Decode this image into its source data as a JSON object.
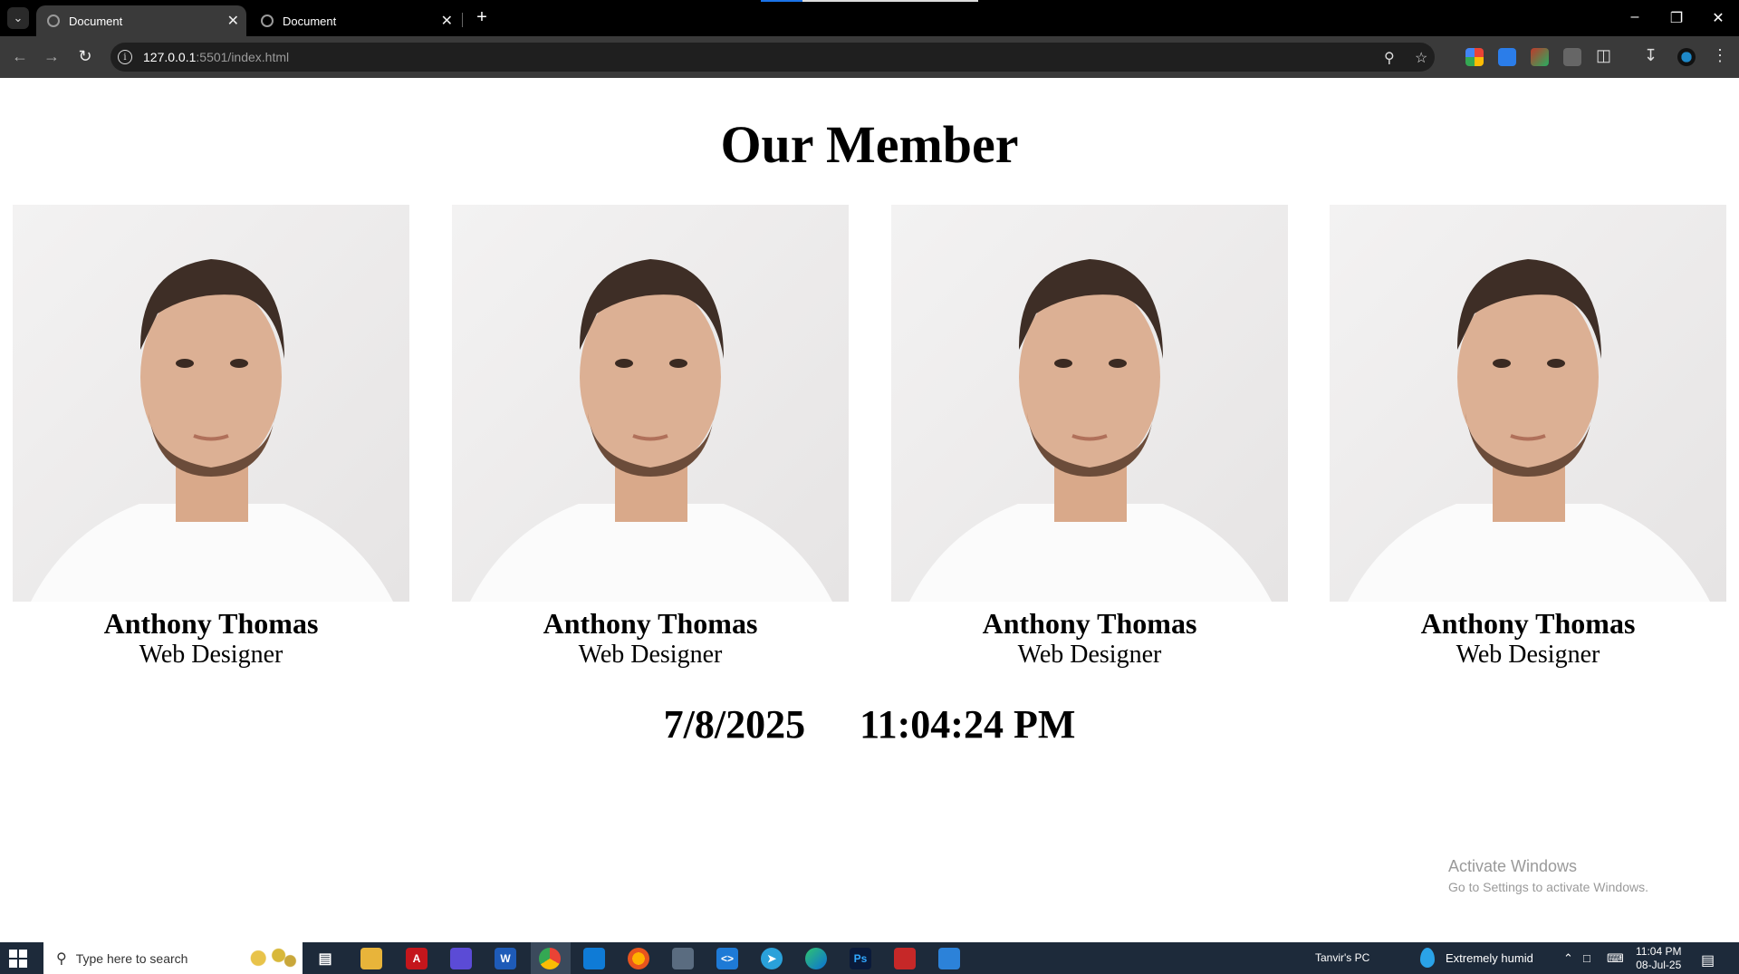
{
  "browser": {
    "tabs": [
      {
        "title": "Document",
        "active": true
      },
      {
        "title": "Document",
        "active": false
      }
    ],
    "new_tab_label": "+",
    "address": {
      "host": "127.0.0.1",
      "rest": ":5501/index.html"
    },
    "icons": [
      "back-icon",
      "forward-icon",
      "reload-icon",
      "site-info-icon",
      "zoom-icon",
      "bookmark-star-icon",
      "extension-icons",
      "extensions-puzzle-icon",
      "download-icon",
      "profile-icon",
      "menu-kebab-icon"
    ]
  },
  "page": {
    "title": "Our Member",
    "members": [
      {
        "name": "Anthony Thomas",
        "role": "Web Designer"
      },
      {
        "name": "Anthony Thomas",
        "role": "Web Designer"
      },
      {
        "name": "Anthony Thomas",
        "role": "Web Designer"
      },
      {
        "name": "Anthony Thomas",
        "role": "Web Designer"
      }
    ],
    "date": "7/8/2025",
    "time": "11:04:24 PM"
  },
  "watermark": {
    "line1": "Activate Windows",
    "line2": "Go to Settings to activate Windows."
  },
  "taskbar": {
    "search_placeholder": "Type here to search",
    "pc_name": "Tanvir's PC",
    "weather": "Extremely humid",
    "clock_time": "11:04 PM",
    "clock_date": "08-Jul-25"
  },
  "colors": {
    "taskbar": "#1d2a3a",
    "toolbar": "#3a3a3a",
    "tabstrip": "#000000"
  }
}
